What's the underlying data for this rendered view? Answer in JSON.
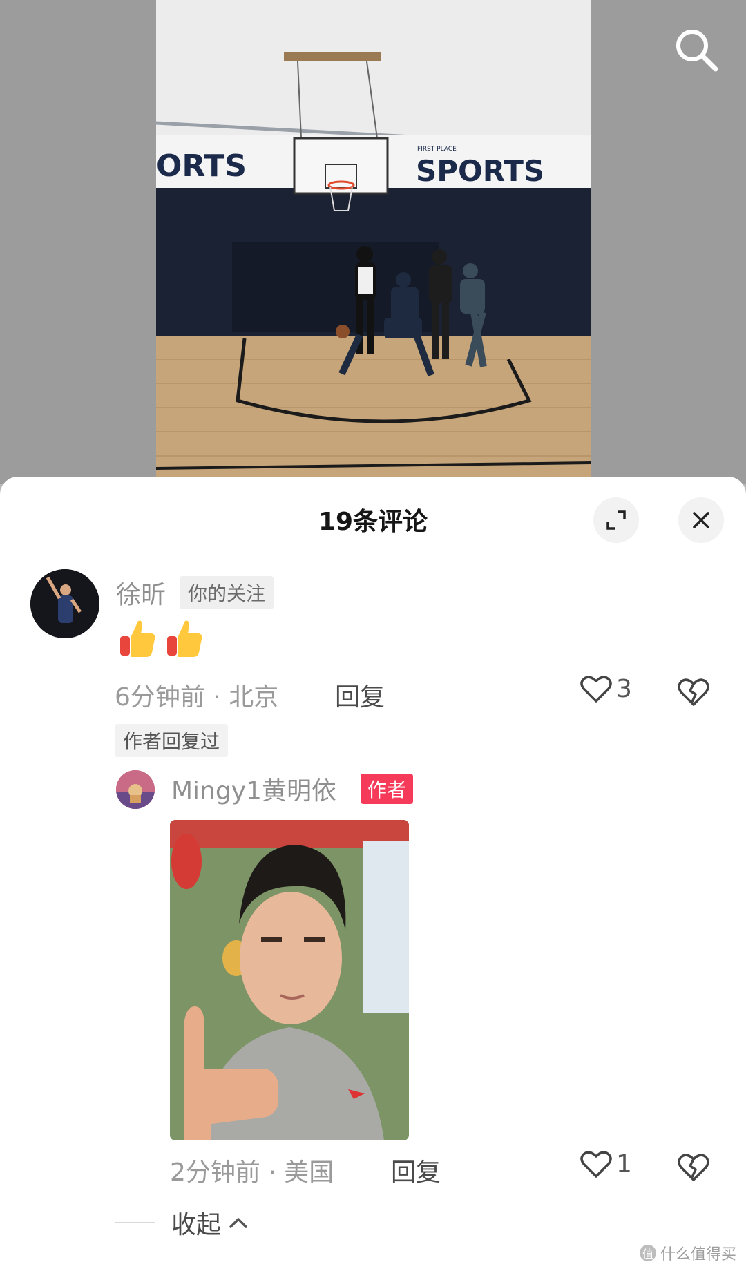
{
  "header": {
    "comment_count_title": "19条评论"
  },
  "comment": {
    "username": "徐昕",
    "follow_tag": "你的关注",
    "emojis": [
      "thumbs-up-emoji",
      "thumbs-up-emoji"
    ],
    "time": "6分钟前",
    "location": "北京",
    "meta": "6分钟前 · 北京",
    "reply_label": "回复",
    "likes": "3",
    "author_replied_tag": "作者回复过"
  },
  "reply": {
    "username": "Mingy1黄明依",
    "author_tag": "作者",
    "time": "2分钟前",
    "location": "美国",
    "meta": "2分钟前 · 美国",
    "reply_label": "回复",
    "likes": "1"
  },
  "collapse": {
    "label": "收起"
  },
  "video": {
    "banner_left": "ORTS",
    "banner_right": "SPORTS",
    "banner_small": "FIRST PLACE"
  },
  "watermark": {
    "badge": "值",
    "text": "什么值得买"
  },
  "icons": [
    "search-icon",
    "expand-icon",
    "close-icon",
    "heart-icon",
    "broken-heart-icon",
    "chevron-up-icon"
  ],
  "colors": {
    "author_tag": "#f63b5a",
    "sheet_bg": "#ffffff",
    "muted_text": "#9a9a9a"
  }
}
